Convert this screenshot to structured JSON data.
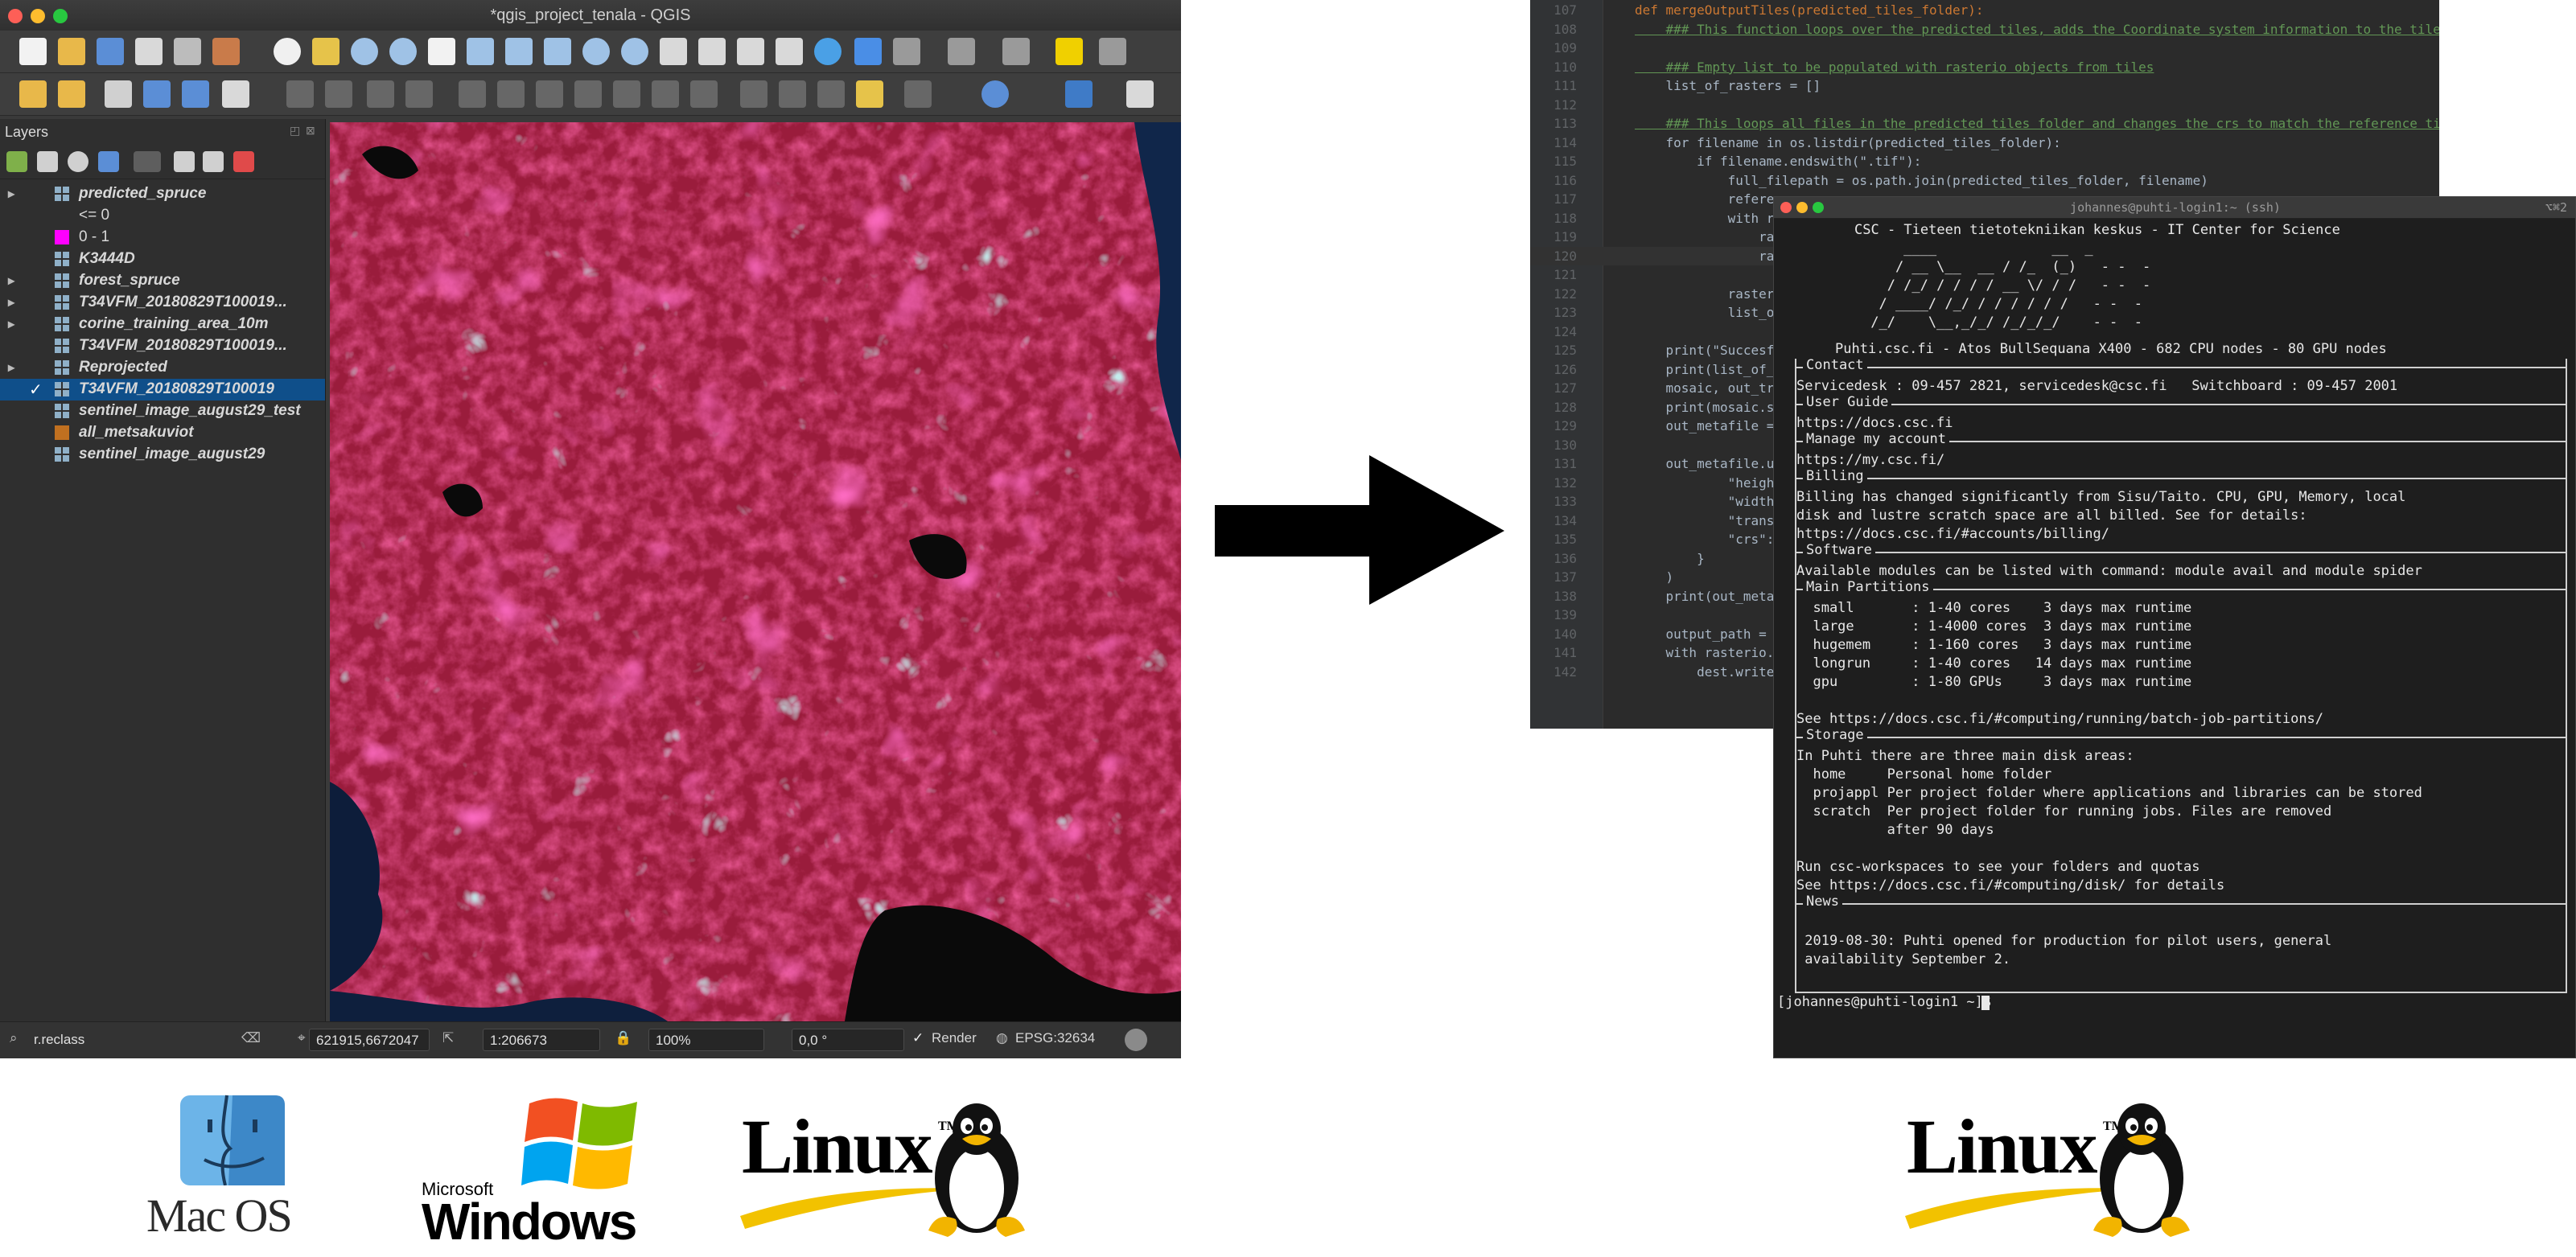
{
  "qgis": {
    "window_title": "*qgis_project_tenala - QGIS",
    "layers_panel_title": "Layers",
    "layers": [
      {
        "name": "predicted_spruce",
        "checked": false,
        "expand": true,
        "icon": "raster-grid-icon"
      },
      {
        "name": "<= 0",
        "legend": true,
        "swatch": ""
      },
      {
        "name": "0 - 1",
        "legend": true,
        "swatch": "#ff00ff"
      },
      {
        "name": "K3444D",
        "icon": "raster-grid-icon"
      },
      {
        "name": "forest_spruce",
        "expand": true,
        "icon": "raster-grid-icon"
      },
      {
        "name": "T34VFM_20180829T100019...",
        "expand": true,
        "icon": "raster-grid-icon"
      },
      {
        "name": "corine_training_area_10m",
        "expand": true,
        "icon": "raster-grid-icon"
      },
      {
        "name": "T34VFM_20180829T100019...",
        "icon": "raster-grid-icon"
      },
      {
        "name": "Reprojected",
        "expand": true,
        "icon": "raster-grid-icon"
      },
      {
        "name": "T34VFM_20180829T100019",
        "checked": true,
        "selected": true,
        "icon": "raster-grid-icon"
      },
      {
        "name": "sentinel_image_august29_test",
        "icon": "raster-grid-icon"
      },
      {
        "name": "all_metsakuviot",
        "icon": "polygon-layer-icon",
        "swatch": "#c07020"
      },
      {
        "name": "sentinel_image_august29",
        "icon": "raster-grid-icon"
      }
    ],
    "status": {
      "search_value": "r.reclass",
      "coordinate": "621915,6672047",
      "scale": "1:206673",
      "magnifier": "100%",
      "rotation": "0,0 °",
      "render_label": "Render",
      "crs": "EPSG:32634"
    }
  },
  "ide": {
    "lines": [
      {
        "n": "107",
        "t": "def mergeOutputTiles(predicted_tiles_folder):"
      },
      {
        "n": "108",
        "t": "    ### This function loops over the predicted tiles, adds the Coordinate system information to the tiles a"
      },
      {
        "n": "109",
        "t": ""
      },
      {
        "n": "110",
        "t": "    ### Empty list to be populated with rasterio objects from tiles"
      },
      {
        "n": "111",
        "t": "    list_of_rasters = []"
      },
      {
        "n": "112",
        "t": ""
      },
      {
        "n": "113",
        "t": "    ### This loops all files in the predicted tiles folder and changes the crs to match the reference tile"
      },
      {
        "n": "114",
        "t": "    for filename in os.listdir(predicted_tiles_folder):"
      },
      {
        "n": "115",
        "t": "        if filename.endswith(\".tif\"):"
      },
      {
        "n": "116",
        "t": "            full_filepath = os.path.join(predicted_tiles_folder, filename)"
      },
      {
        "n": "117",
        "t": "            reference_"
      },
      {
        "n": "118",
        "t": "            with raste"
      },
      {
        "n": "119",
        "t": "                raster"
      },
      {
        "n": "120",
        "t": "                raster"
      },
      {
        "n": "121",
        "t": ""
      },
      {
        "n": "122",
        "t": "            raster = r"
      },
      {
        "n": "123",
        "t": "            list_of_ra"
      },
      {
        "n": "124",
        "t": ""
      },
      {
        "n": "125",
        "t": "    print(\"Succesfully"
      },
      {
        "n": "126",
        "t": "    print(list_of_rast"
      },
      {
        "n": "127",
        "t": "    mosaic, out_trans "
      },
      {
        "n": "128",
        "t": "    print(mosaic.shape"
      },
      {
        "n": "129",
        "t": "    out_metafile = ras"
      },
      {
        "n": "130",
        "t": ""
      },
      {
        "n": "131",
        "t": "    out_metafile.updat"
      },
      {
        "n": "132",
        "t": "            \"height\":"
      },
      {
        "n": "133",
        "t": "            \"width\": m"
      },
      {
        "n": "134",
        "t": "            \"transform"
      },
      {
        "n": "135",
        "t": "            \"crs\": \"+p"
      },
      {
        "n": "136",
        "t": "        }"
      },
      {
        "n": "137",
        "t": "    )"
      },
      {
        "n": "138",
        "t": "    print(out_metafile"
      },
      {
        "n": "139",
        "t": ""
      },
      {
        "n": "140",
        "t": "    output_path = os.p"
      },
      {
        "n": "141",
        "t": "    with rasterio.oper"
      },
      {
        "n": "142",
        "t": "        dest.write(mos"
      }
    ]
  },
  "terminal": {
    "title": "johannes@puhti-login1:~ (ssh)",
    "shortcut": "⌥⌘2",
    "banner_line": "CSC - Tieteen tietotekniikan keskus - IT Center for Science",
    "ascii_art": [
      "     ____              __  _",
      "    / __ \\__  __ / /_  (_)   - -  -",
      "   / /_/ / / / / __ \\/ / /   - -  -",
      "  / ____/ /_/ / / / / / /   - -  -",
      " /_/    \\__,_/_/ /_/_/_/    - -  -"
    ],
    "system_line": "Puhti.csc.fi - Atos BullSequana X400 - 682 CPU nodes - 80 GPU nodes",
    "sections": [
      {
        "title": "Contact",
        "lines": [
          "Servicedesk : 09-457 2821, servicedesk@csc.fi   Switchboard : 09-457 2001"
        ]
      },
      {
        "title": "User Guide",
        "lines": [
          "https://docs.csc.fi"
        ]
      },
      {
        "title": "Manage my account",
        "lines": [
          "https://my.csc.fi/"
        ]
      },
      {
        "title": "Billing",
        "lines": [
          "Billing has changed significantly from Sisu/Taito. CPU, GPU, Memory, local",
          "disk and lustre scratch space are all billed. See for details:",
          "https://docs.csc.fi/#accounts/billing/"
        ]
      },
      {
        "title": "Software",
        "lines": [
          "Available modules can be listed with command: module avail and module spider"
        ]
      },
      {
        "title": "Main Partitions",
        "lines": [
          "  small       : 1-40 cores    3 days max runtime",
          "  large       : 1-4000 cores  3 days max runtime",
          "  hugemem     : 1-160 cores   3 days max runtime",
          "  longrun     : 1-40 cores   14 days max runtime",
          "  gpu         : 1-80 GPUs     3 days max runtime",
          "",
          "See https://docs.csc.fi/#computing/running/batch-job-partitions/"
        ]
      },
      {
        "title": "Storage",
        "lines": [
          "In Puhti there are three main disk areas:",
          "  home     Personal home folder",
          "  projappl Per project folder where applications and libraries can be stored",
          "  scratch  Per project folder for running jobs. Files are removed",
          "           after 90 days",
          "",
          "Run csc-workspaces to see your folders and quotas",
          "See https://docs.csc.fi/#computing/disk/ for details"
        ]
      },
      {
        "title": "News",
        "lines": [
          "",
          " 2019-08-30: Puhti opened for production for pilot users, general",
          " availability September 2."
        ]
      }
    ],
    "prompt": "[johannes@puhti-login1 ~]$ "
  },
  "logos": {
    "macos": "Mac OS",
    "windows_small": "Microsoft",
    "windows": "Windows",
    "linux": "Linux",
    "linux_tm": "TM"
  },
  "colors": {
    "magenta": "#ff00ff",
    "qgis_bg": "#3a3a3a",
    "terminal_bg": "#1e1e1e",
    "ide_bg": "#2b2b2b"
  }
}
